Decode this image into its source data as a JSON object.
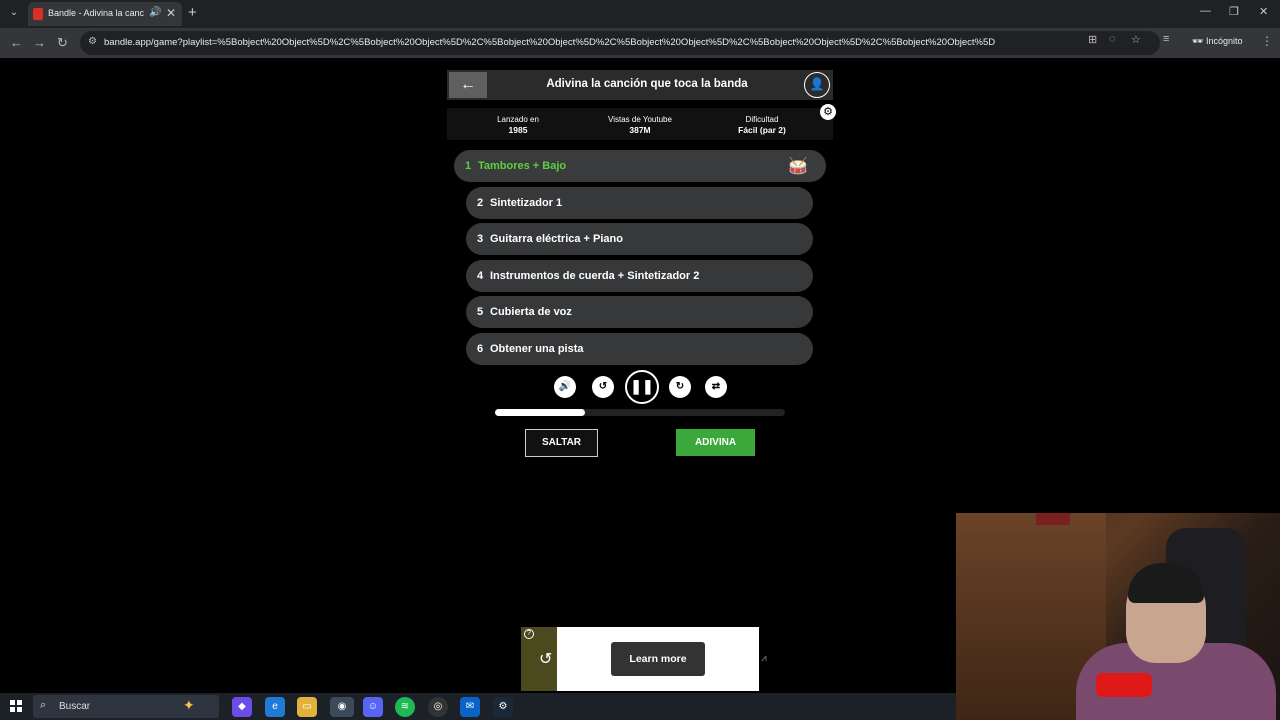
{
  "browser": {
    "tab_title": "Bandle - Adivina la canción",
    "url": "bandle.app/game?playlist=%5Bobject%20Object%5D%2C%5Bobject%20Object%5D%2C%5Bobject%20Object%5D%2C%5Bobject%20Object%5D%2C%5Bobject%20Object%5D%2C%5Bobject%20Object%5D",
    "incognito_label": "Incógnito"
  },
  "game": {
    "title": "Adivina la canción que toca la banda",
    "info": [
      {
        "label": "Lanzado en",
        "value": "1985"
      },
      {
        "label": "Vistas de Youtube",
        "value": "387M"
      },
      {
        "label": "Dificultad",
        "value": "Fácil (par 2)"
      }
    ],
    "tracks": [
      {
        "num": "1",
        "name": "Tambores + Bajo"
      },
      {
        "num": "2",
        "name": "Sintetizador 1"
      },
      {
        "num": "3",
        "name": "Guitarra eléctrica + Piano"
      },
      {
        "num": "4",
        "name": "Instrumentos de cuerda + Sintetizador 2"
      },
      {
        "num": "5",
        "name": "Cubierta de voz"
      },
      {
        "num": "6",
        "name": "Obtener una pista"
      }
    ],
    "progress_fraction": 0.31,
    "skip_label": "SALTAR",
    "guess_label": "ADIVINA",
    "accent_color": "#5ecf3e",
    "guess_color": "#3aa83a"
  },
  "ad": {
    "button_label": "Learn more"
  },
  "taskbar": {
    "search_placeholder": "Buscar"
  }
}
